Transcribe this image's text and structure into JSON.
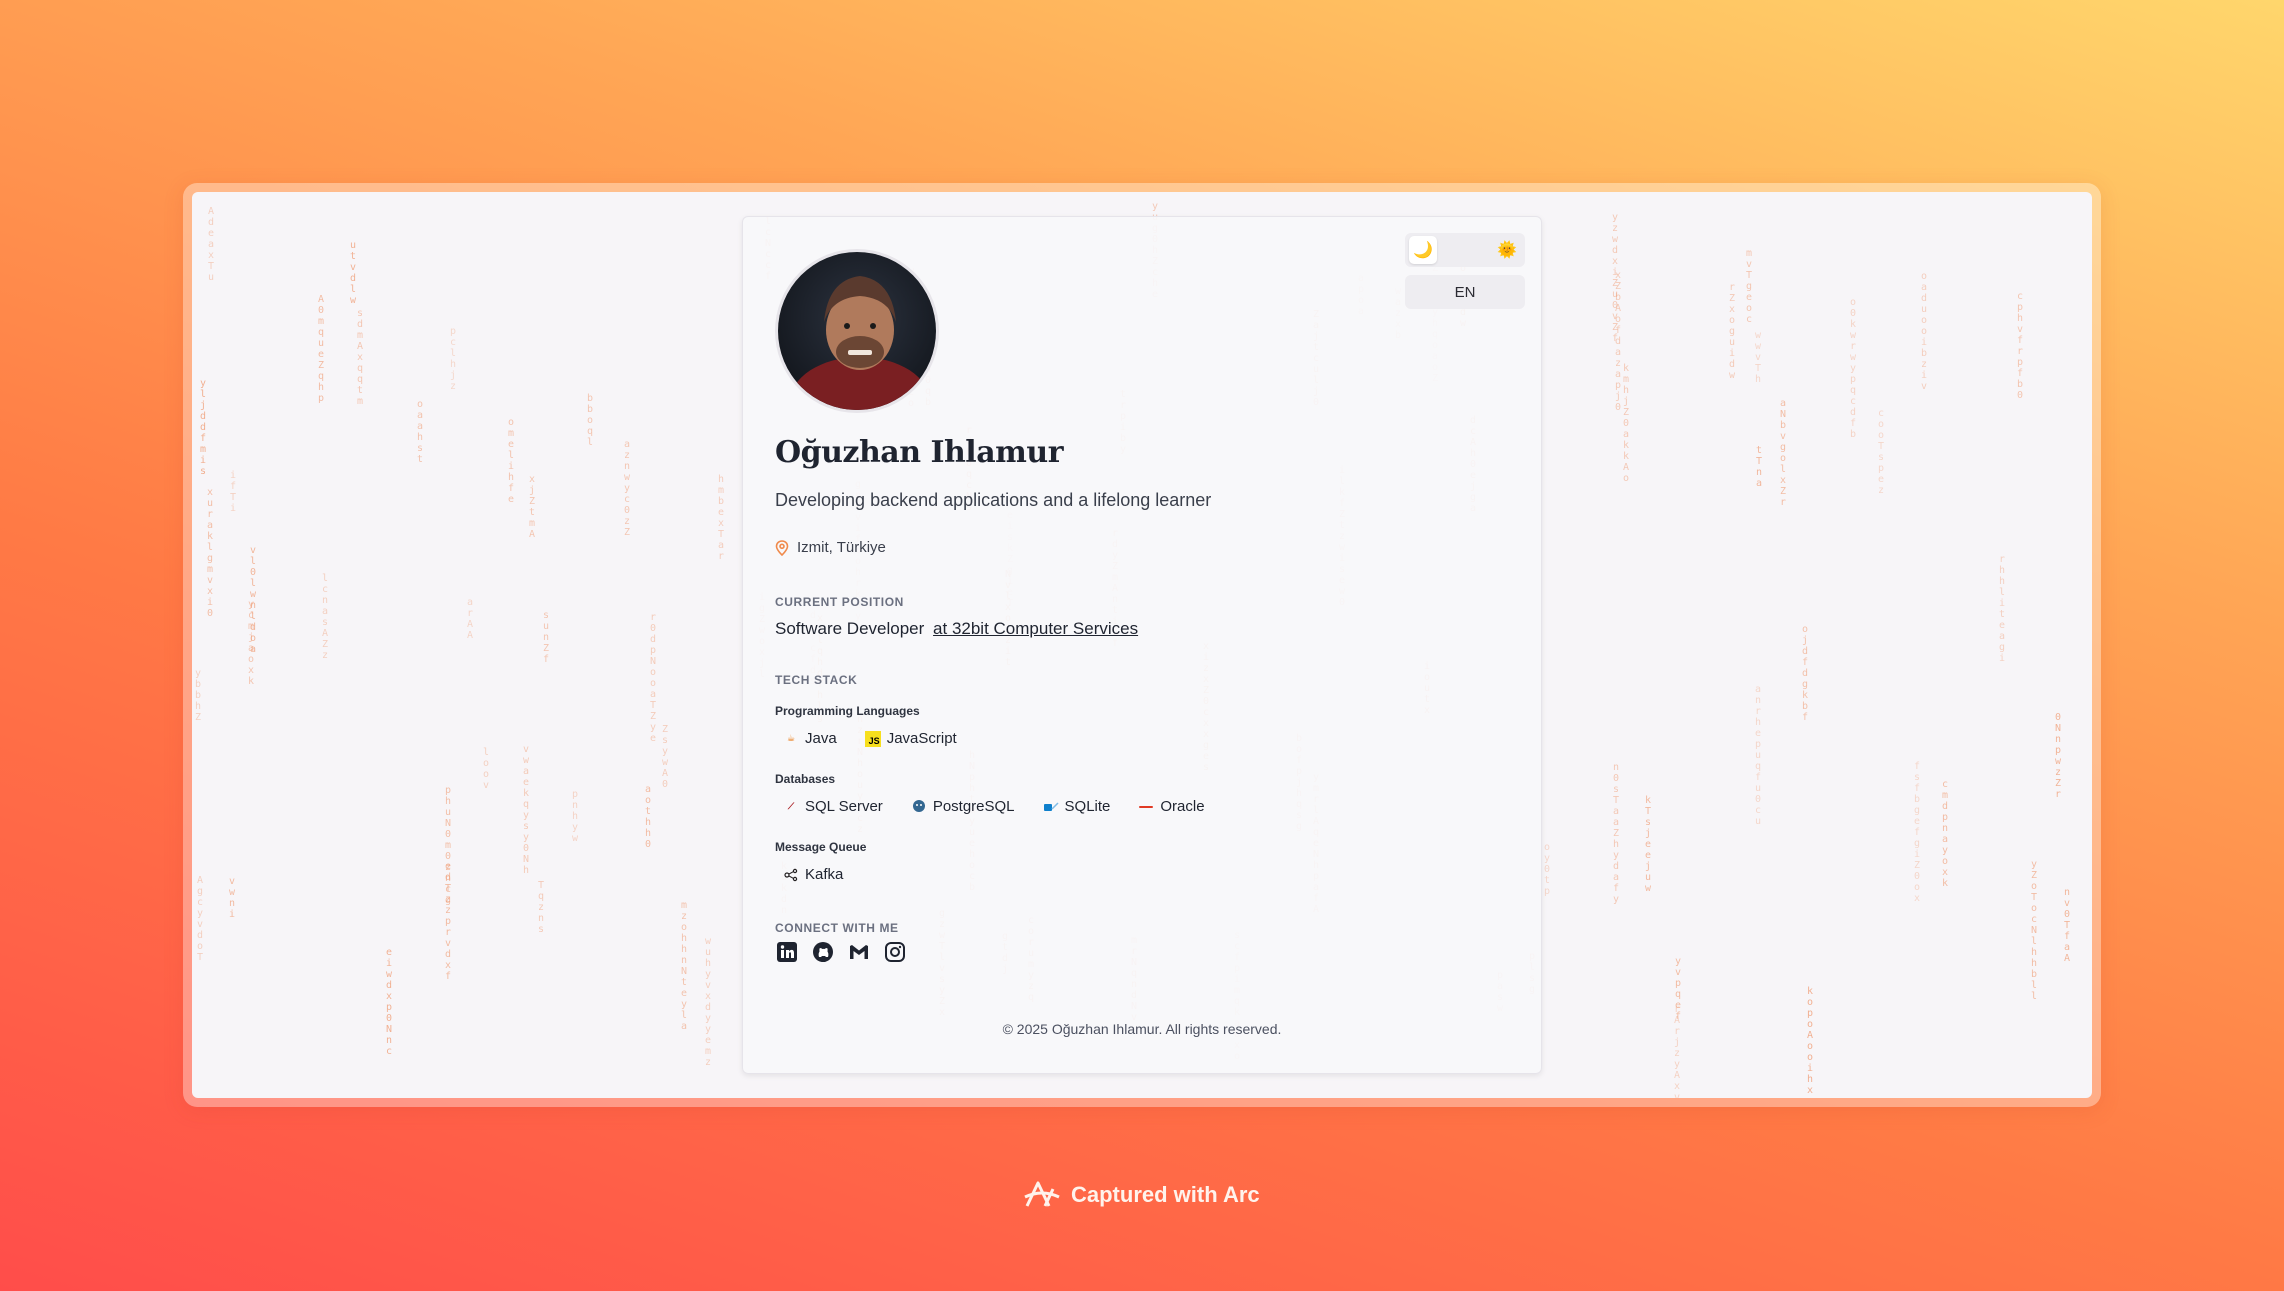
{
  "profile": {
    "name": "Oğuzhan Ihlamur",
    "tagline": "Developing backend applications and a lifelong learner",
    "location": "Izmit, Türkiye"
  },
  "controls": {
    "language": "EN",
    "theme_dark_icon": "moon-icon",
    "theme_light_icon": "sun-icon"
  },
  "current_position": {
    "title": "CURRENT POSITION",
    "role": "Software Developer",
    "company_link": "at 32bit Computer Services"
  },
  "tech_stack": {
    "title": "TECH STACK",
    "groups": [
      {
        "label": "Programming Languages",
        "items": [
          {
            "name": "Java",
            "icon": "java-icon"
          },
          {
            "name": "JavaScript",
            "icon": "javascript-icon"
          }
        ]
      },
      {
        "label": "Databases",
        "items": [
          {
            "name": "SQL Server",
            "icon": "sql-server-icon"
          },
          {
            "name": "PostgreSQL",
            "icon": "postgresql-icon"
          },
          {
            "name": "SQLite",
            "icon": "sqlite-icon"
          },
          {
            "name": "Oracle",
            "icon": "oracle-icon"
          }
        ]
      },
      {
        "label": "Message Queue",
        "items": [
          {
            "name": "Kafka",
            "icon": "kafka-icon"
          }
        ]
      }
    ]
  },
  "connect": {
    "title": "CONNECT WITH ME",
    "icons": [
      "linkedin-icon",
      "github-icon",
      "gmail-icon",
      "instagram-icon"
    ]
  },
  "footer": {
    "text": "© 2025 Oğuzhan Ihlamur. All rights reserved."
  },
  "capture_badge": {
    "text": "Captured with Arc"
  },
  "colors": {
    "accent": "#f08a4b",
    "text": "#1f2430",
    "muted": "#6b7080"
  }
}
